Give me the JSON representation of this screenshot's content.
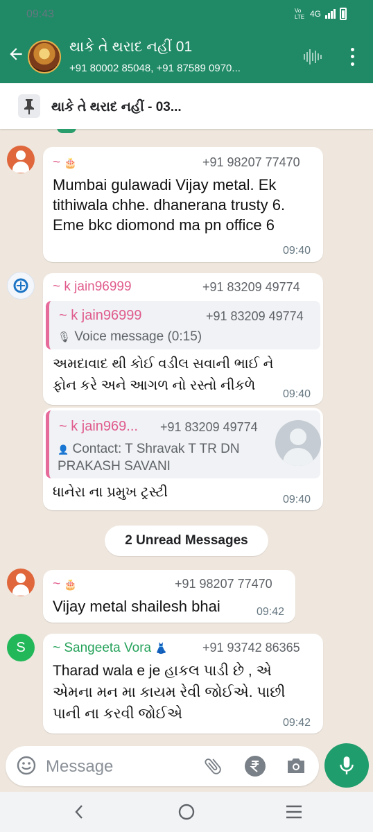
{
  "status_bar": {
    "time": "09:43",
    "network_label": "Vo LTE",
    "network_type": "4G"
  },
  "header": {
    "title": "થાકે તે થરાદ નહીં 01",
    "subtitle": "+91 80002 85048, +91 87589 0970..."
  },
  "pinned": {
    "text": "થાકે તે થરાદ નહીં - 03..."
  },
  "messages": [
    {
      "sender": "~",
      "sender_emoji": "🎂",
      "phone": "+91 98207 77470",
      "body": "Mumbai gulawadi Vijay metal.  Ek tithiwala  chhe. dhanerana trusty 6.  Eme bkc diomond ma pn office 6",
      "time": "09:40"
    },
    {
      "sender": "~ k jain96999",
      "phone": "+91 83209 49774",
      "quote": {
        "name": "~ k jain96999",
        "phone": "+91 83209 49774",
        "text": "Voice message (0:15)"
      },
      "body": "અમદાવાદ થી કોઈ વડીલ સવાની ભાઈ ને ફોન કરે અને આગળ નો રસ્તો નીકળે",
      "time": "09:40"
    },
    {
      "quote": {
        "name": "~ k jain969...",
        "phone": "+91 83209 49774",
        "text": "Contact: T Shravak T TR DN PRAKASH SAVANI"
      },
      "body": "ધાનેરા ના પ્રમુખ ટ્રસ્ટી",
      "time": "09:40"
    },
    {
      "sender": "~",
      "sender_emoji": "🎂",
      "phone": "+91 98207 77470",
      "body": "Vijay metal shailesh bhai",
      "time": "09:42"
    },
    {
      "sender": "~ Sangeeta Vora",
      "sender_emoji": "👗",
      "avatar_letter": "S",
      "phone": "+91 93742 86365",
      "body": "Tharad wala e je હાકલ પાડી છે , એ એમના મન મા કાયમ રેવી જોઈએ.  પાછી પાની ના કરવી જોઈએ",
      "time": "09:42"
    }
  ],
  "unread_label": "2 Unread Messages",
  "composer": {
    "placeholder": "Message"
  },
  "colors": {
    "header_green": "#1f8a65",
    "chat_bg": "#efe7de",
    "sender_pink": "#e05b8c",
    "sender_green": "#25a25a",
    "mic_green": "#1f9d6c"
  },
  "icons": [
    "back-arrow-icon",
    "voice-chat-icon",
    "more-options-icon",
    "pin-icon",
    "microphone-icon",
    "contact-icon",
    "emoji-icon",
    "attach-icon",
    "rupee-icon",
    "camera-icon",
    "mic-icon",
    "nav-back-icon",
    "nav-home-icon",
    "nav-recents-icon"
  ]
}
